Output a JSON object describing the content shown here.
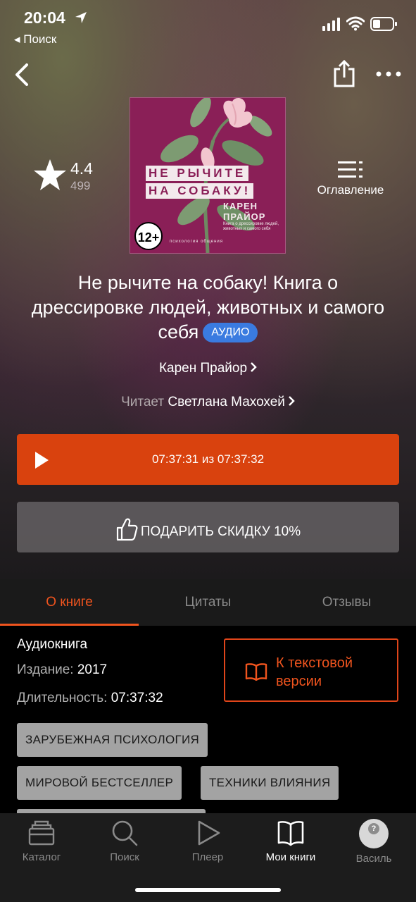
{
  "status_bar": {
    "time": "20:04",
    "back_app": "◂ Поиск"
  },
  "rating": {
    "value": "4.4",
    "count": "499"
  },
  "toc": {
    "label": "Оглавление"
  },
  "cover": {
    "title_line1": "НЕ РЫЧИТЕ",
    "title_line2": "НА СОБАКУ!",
    "author_line1": "КАРЕН",
    "author_line2": "ПРАЙОР",
    "description": "Книга о дрессировке людей, животных и самого себя",
    "age": "12+",
    "series": "психология общения"
  },
  "book": {
    "title": "Не рычите на собаку! Книга о дрессировке людей, животных и самого себя",
    "badge": "АУДИО",
    "author": "Карен Прайор",
    "narrator_prefix": "Читает",
    "narrator": "Светлана Махохей"
  },
  "player": {
    "progress_text": "07:37:31 из 07:37:32"
  },
  "gift_button": {
    "label": "ПОДАРИТЬ СКИДКУ 10%"
  },
  "tabs": [
    {
      "label": "О книге"
    },
    {
      "label": "Цитаты"
    },
    {
      "label": "Отзывы"
    }
  ],
  "details": {
    "type": "Аудиокнига",
    "edition_key": "Издание:",
    "edition_value": "2017",
    "duration_key": "Длительность:",
    "duration_value": "07:37:32",
    "text_version_line1": "К текстовой",
    "text_version_line2": "версии"
  },
  "tags": [
    {
      "label": "ЗАРУБЕЖНАЯ ПСИХОЛОГИЯ"
    },
    {
      "label": "МИРОВОЙ БЕСТСЕЛЛЕР"
    },
    {
      "label": "ТЕХНИКИ ВЛИЯНИЯ"
    }
  ],
  "tabbar": [
    {
      "label": "Каталог",
      "icon": "catalog-icon"
    },
    {
      "label": "Поиск",
      "icon": "search-icon"
    },
    {
      "label": "Плеер",
      "icon": "play-icon"
    },
    {
      "label": "Мои книги",
      "icon": "book-icon"
    },
    {
      "label": "Василь",
      "icon": "avatar"
    }
  ],
  "colors": {
    "accent": "#d9420e",
    "badge": "#3a7be0",
    "cover": "#8a1f57"
  }
}
